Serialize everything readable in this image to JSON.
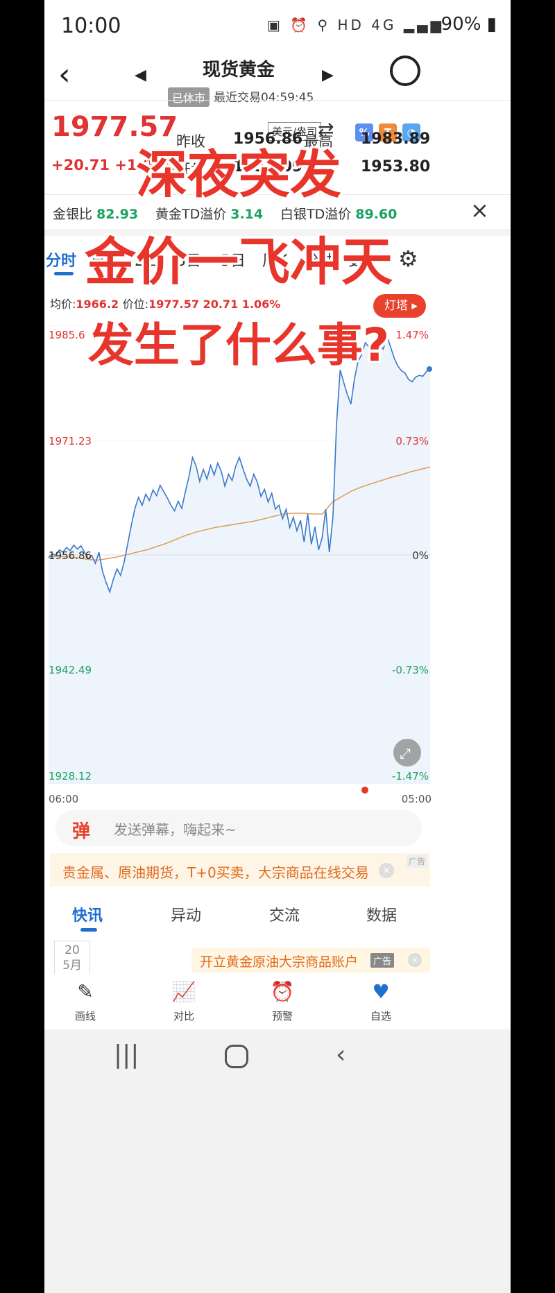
{
  "status": {
    "time": "10:00",
    "icons": "▣ ⏰ ⚲ HD 4G ▂▄▆",
    "battery": "90% ▮"
  },
  "header": {
    "title": "现货黄金",
    "market_state": "已休市",
    "last_trade": "最近交易04:59:45"
  },
  "quote": {
    "price": "1977.57",
    "change": "+20.71 +1.06%",
    "currency_btn": "美元/盎司",
    "prev_close_label": "昨收",
    "prev_close": "1956.86",
    "high_label": "最高",
    "high": "1983.89",
    "open_label": "开盘",
    "open": "1956.09",
    "low_label": "最低",
    "low": "1953.80"
  },
  "indicators": [
    {
      "label": "金银比",
      "value": "82.93"
    },
    {
      "label": "黄金TD溢价",
      "value": "3.14"
    },
    {
      "label": "白银TD溢价",
      "value": "89.60"
    }
  ],
  "tabs": [
    "分时",
    "日K",
    "2日",
    "3日",
    "5日",
    "周K",
    "分钟",
    "更多"
  ],
  "chart_info": {
    "avg_label": "均价:",
    "avg_value": "1966.2",
    "price_label": "价位:",
    "price_value": "1977.57 20.71 1.06%",
    "lamp_button": "灯塔 ▸"
  },
  "chart_data": {
    "type": "line",
    "x_start": "06:00",
    "x_end": "05:00",
    "y_ticks_left": [
      "1985.6",
      "1971.23",
      "1956.86",
      "1942.49",
      "1928.12"
    ],
    "y_ticks_right": [
      "1.47%",
      "0.73%",
      "0%",
      "-0.73%",
      "-1.47%"
    ],
    "ylim": [
      1928.12,
      1985.6
    ],
    "base": 1956.86,
    "series": [
      {
        "values": [
          1956.5,
          1957.0,
          1956.8,
          1957.5,
          1957.2,
          1957.8,
          1957.4,
          1958.1,
          1957.6,
          1958.0,
          1957.2,
          1956.4,
          1956.8,
          1955.8,
          1957.2,
          1954.8,
          1953.4,
          1952.2,
          1953.8,
          1955.1,
          1954.3,
          1956.0,
          1958.3,
          1960.6,
          1962.7,
          1964.1,
          1963.1,
          1964.5,
          1963.7,
          1965.0,
          1964.3,
          1965.6,
          1964.8,
          1964.0,
          1963.1,
          1962.4,
          1963.6,
          1962.7,
          1964.8,
          1966.7,
          1969.1,
          1968.0,
          1966.1,
          1967.6,
          1966.4,
          1968.1,
          1966.9,
          1968.4,
          1967.3,
          1965.5,
          1967.0,
          1966.2,
          1968.0,
          1969.1,
          1967.7,
          1966.4,
          1965.5,
          1967.0,
          1966.0,
          1964.2,
          1965.1,
          1963.5,
          1964.6,
          1962.6,
          1963.1,
          1961.4,
          1962.6,
          1960.3,
          1961.6,
          1959.9,
          1961.2,
          1958.5,
          1962.0,
          1958.2,
          1960.4,
          1957.5,
          1959.0,
          1962.6,
          1957.2,
          1961.6,
          1973.3,
          1980.1,
          1978.5,
          1977.0,
          1975.8,
          1979.0,
          1981.2,
          1982.0,
          1983.5,
          1983.0,
          1982.6,
          1983.9,
          1983.2,
          1982.7,
          1984.4,
          1983.0,
          1981.6,
          1980.6,
          1980.0,
          1979.7,
          1978.9,
          1978.6,
          1979.2,
          1979.4,
          1979.3,
          1979.9,
          1980.2
        ]
      },
      {
        "values": [
          1956.6,
          1956.7,
          1956.6,
          1956.5,
          1956.3,
          1956.2,
          1956.4,
          1956.6,
          1956.9,
          1957.2,
          1957.5,
          1957.9,
          1958.3,
          1958.8,
          1959.3,
          1959.7,
          1960.0,
          1960.3,
          1960.5,
          1960.7,
          1960.9,
          1961.1,
          1961.4,
          1961.7,
          1962.0,
          1962.1,
          1962.1,
          1962.0,
          1962.0,
          1963.5,
          1964.2,
          1964.9,
          1965.4,
          1965.8,
          1966.2,
          1966.6,
          1966.9,
          1967.3,
          1967.6,
          1967.9
        ]
      }
    ]
  },
  "caption": {
    "line1": "深夜突发",
    "line2": "金价一飞冲天",
    "line3": "发生了什么事?"
  },
  "danmu": {
    "icon": "弹",
    "placeholder": "发送弹幕，嗨起来~"
  },
  "ad": {
    "text": "贵金属、原油期货，T+0买卖，大宗商品在线交易",
    "tag": "广告",
    "close": "×"
  },
  "news_tabs": [
    "快讯",
    "异动",
    "交流",
    "数据"
  ],
  "date_box": {
    "day": "20",
    "month": "5月"
  },
  "ad2": {
    "text": "开立黄金原油大宗商品账户",
    "tag": "广告",
    "close": "×"
  },
  "bottom_nav": [
    {
      "icon": "✎",
      "label": "画线"
    },
    {
      "icon": "📈",
      "label": "对比"
    },
    {
      "icon": "⏰",
      "label": "预警"
    },
    {
      "icon": "♥",
      "label": "自选"
    }
  ],
  "colors": {
    "up": "#e03333",
    "down": "#1aa260",
    "accent": "#1f6fd1",
    "price_line": "#3a78c9",
    "avg_line": "#e0a05a"
  }
}
